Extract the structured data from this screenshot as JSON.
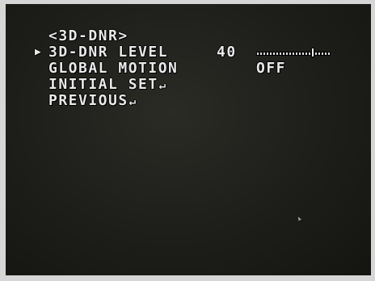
{
  "menu": {
    "title": "<3D-DNR>",
    "cursor_glyph": "▶",
    "enter_glyph": "↵",
    "items": [
      {
        "label": "3D-DNR LEVEL",
        "value": "40",
        "level_fraction": 0.75,
        "selected": true
      },
      {
        "label": "GLOBAL MOTION",
        "value": "OFF"
      },
      {
        "label": "INITIAL SET"
      },
      {
        "label": "PREVIOUS"
      }
    ]
  },
  "colors": {
    "osd_text": "#e9e9e9",
    "screen_bg": "#1d1e1a",
    "bezel": "#d6d6d6"
  }
}
